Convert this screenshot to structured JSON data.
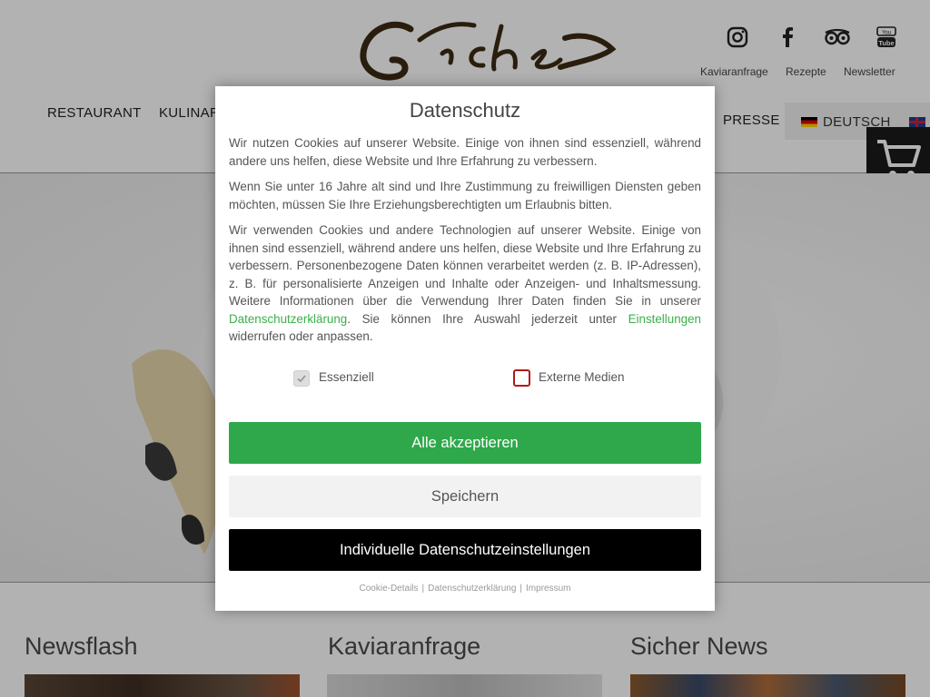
{
  "header": {
    "social": [
      {
        "icon": "instagram-icon"
      },
      {
        "icon": "facebook-icon"
      },
      {
        "icon": "tripadvisor-icon"
      },
      {
        "icon": "youtube-icon"
      }
    ],
    "top_links": [
      "Kaviaranfrage",
      "Rezepte",
      "Newsletter"
    ],
    "nav": [
      "RESTAURANT",
      "KULINAR",
      "PRESSE"
    ],
    "languages": [
      "DEUTSCH"
    ]
  },
  "columns": [
    {
      "title": "Newsflash"
    },
    {
      "title": "Kaviaranfrage"
    },
    {
      "title": "Sicher News"
    }
  ],
  "modal": {
    "title": "Datenschutz",
    "p1": "Wir nutzen Cookies auf unserer Website. Einige von ihnen sind essenziell, während andere uns helfen, diese Website und Ihre Erfahrung zu verbessern.",
    "p2": "Wenn Sie unter 16 Jahre alt sind und Ihre Zustimmung zu freiwilligen Diensten geben möchten, müssen Sie Ihre Erziehungsberechtigten um Erlaubnis bitten.",
    "p3_start": "Wir verwenden Cookies und andere Technologien auf unserer Website. Einige von ihnen sind essenziell, während andere uns helfen, diese Website und Ihre Erfahrung zu verbessern. Personenbezogene Daten können verarbeitet werden (z. B. IP-Adressen), z. B. für personalisierte Anzeigen und Inhalte oder Anzeigen- und Inhaltsmessung. Weitere Informationen über die Verwendung Ihrer Daten finden Sie in unserer ",
    "p3_link1": "Datenschutzerklärung",
    "p3_mid": ". Sie können Ihre Auswahl jederzeit unter ",
    "p3_link2": "Einstellungen",
    "p3_end": " widerrufen oder anpassen.",
    "checkbox_essential": "Essenziell",
    "checkbox_external": "Externe Medien",
    "btn_accept": "Alle akzeptieren",
    "btn_save": "Speichern",
    "btn_individual": "Individuelle Datenschutzeinstellungen",
    "footer_links": [
      "Cookie-Details",
      "Datenschutzerklärung",
      "Impressum"
    ]
  },
  "colors": {
    "accept": "#2ea84a",
    "link": "#3cae4b",
    "phone_widget": "#c07a10",
    "logo": "#3b2a14"
  }
}
